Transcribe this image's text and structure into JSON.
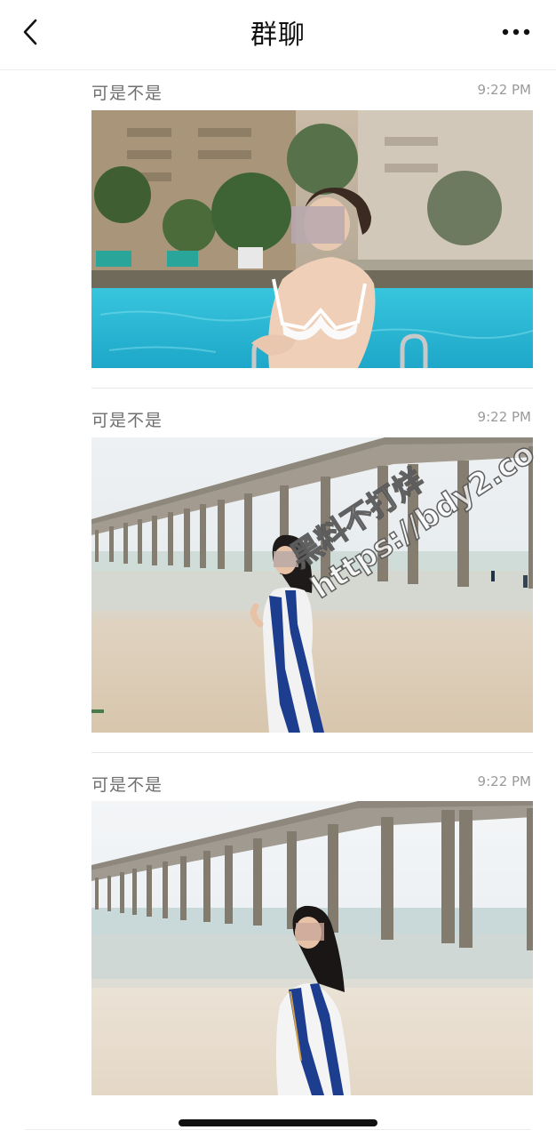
{
  "navbar": {
    "title": "群聊",
    "back_icon": "chevron-left-icon",
    "more_icon": "more-horizontal-icon"
  },
  "messages": [
    {
      "sender": "可是不是",
      "time": "9:22 PM",
      "photo": "pool-photo"
    },
    {
      "sender": "可是不是",
      "time": "9:22 PM",
      "photo": "pier-photo"
    },
    {
      "sender": "可是不是",
      "time": "9:22 PM",
      "photo": "pier-photo-2"
    }
  ],
  "watermark": {
    "line1": "黑料不打烊",
    "line2": "https://bdy2.co"
  }
}
